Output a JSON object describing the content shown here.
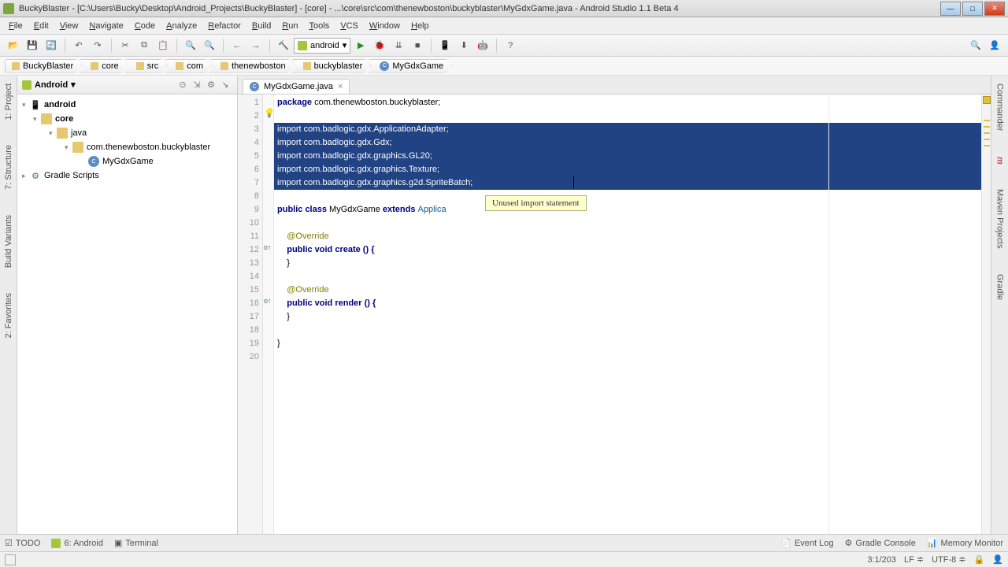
{
  "window": {
    "title": "BuckyBlaster - [C:\\Users\\Bucky\\Desktop\\Android_Projects\\BuckyBlaster] - [core] - ...\\core\\src\\com\\thenewboston\\buckyblaster\\MyGdxGame.java - Android Studio 1.1 Beta 4"
  },
  "menu": [
    "File",
    "Edit",
    "View",
    "Navigate",
    "Code",
    "Analyze",
    "Refactor",
    "Build",
    "Run",
    "Tools",
    "VCS",
    "Window",
    "Help"
  ],
  "toolbar": {
    "run_config": "android"
  },
  "breadcrumbs": [
    "BuckyBlaster",
    "core",
    "src",
    "com",
    "thenewboston",
    "buckyblaster",
    "MyGdxGame"
  ],
  "project": {
    "view_mode": "Android",
    "tree": {
      "root": "android",
      "core": "core",
      "java": "java",
      "pkg": "com.thenewboston.buckyblaster",
      "cls": "MyGdxGame",
      "scripts": "Gradle Scripts"
    }
  },
  "left_tabs": [
    "1: Project",
    "7: Structure",
    "Build Variants",
    "2: Favorites"
  ],
  "right_tabs": [
    "Commander",
    "Maven Projects",
    "Gradle"
  ],
  "editor": {
    "tab_label": "MyGdxGame.java",
    "tooltip": "Unused import statement",
    "lines": {
      "l1": "package com.thenewboston.buckyblaster;",
      "l3": "import com.badlogic.gdx.ApplicationAdapter;",
      "l4": "import com.badlogic.gdx.Gdx;",
      "l5": "import com.badlogic.gdx.graphics.GL20;",
      "l6": "import com.badlogic.gdx.graphics.Texture;",
      "l7": "import com.badlogic.gdx.graphics.g2d.SpriteBatch;",
      "l9a": "public class ",
      "l9b": "MyGdxGame",
      "l9c": " extends ",
      "l9d": "Applica",
      "l11": "    @Override",
      "l12": "    public void create () {",
      "l13": "    }",
      "l15": "    @Override",
      "l16": "    public void render () {",
      "l17": "    }",
      "l19": "}"
    },
    "line_numbers": [
      "1",
      "2",
      "3",
      "4",
      "5",
      "6",
      "7",
      "8",
      "9",
      "10",
      "11",
      "12",
      "13",
      "14",
      "15",
      "16",
      "17",
      "18",
      "19",
      "20"
    ]
  },
  "bottom_tabs": {
    "todo": "TODO",
    "android": "6: Android",
    "terminal": "Terminal",
    "event_log": "Event Log",
    "gradle_console": "Gradle Console",
    "memory_monitor": "Memory Monitor"
  },
  "status": {
    "position": "3:1/203",
    "line_end": "LF",
    "encoding": "UTF-8"
  },
  "colors": {
    "selection": "#214283",
    "tooltip_bg": "#ffffcc"
  }
}
